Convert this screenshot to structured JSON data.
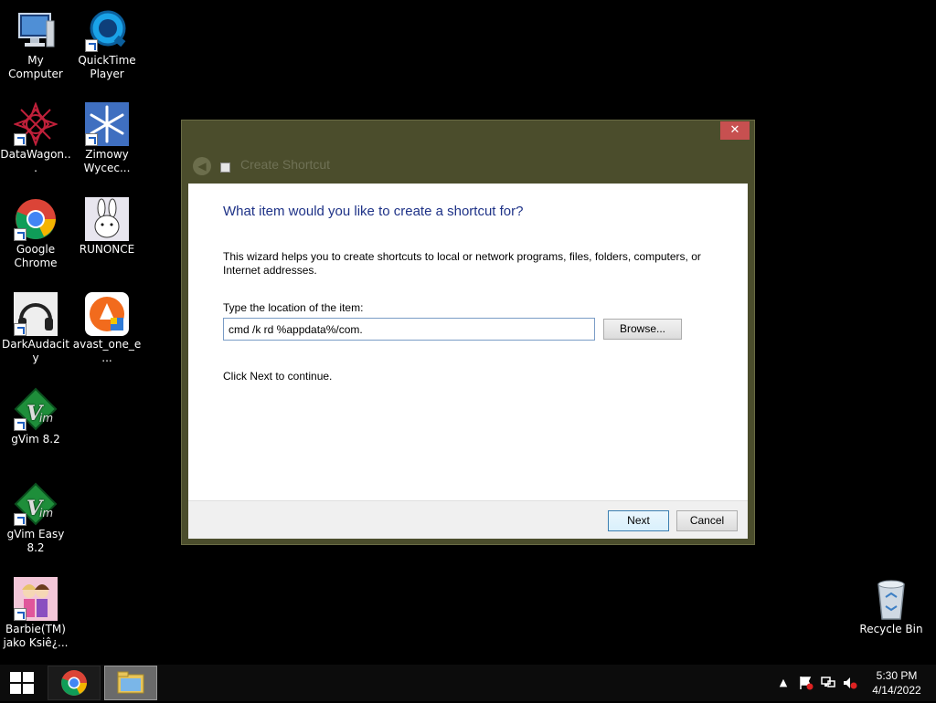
{
  "desktop": {
    "icons": [
      {
        "label": "My Computer",
        "icon": "computer-icon"
      },
      {
        "label": "QuickTime\nPlayer",
        "icon": "quicktime-icon"
      },
      {
        "label": "DataWagon...",
        "icon": "datawagon-icon"
      },
      {
        "label": "Zimowy\nWycec...",
        "icon": "snowflake-icon"
      },
      {
        "label": "Google\nChrome",
        "icon": "chrome-icon"
      },
      {
        "label": "RUNONCE",
        "icon": "rabbit-icon"
      },
      {
        "label": "DarkAudacity",
        "icon": "headphones-icon"
      },
      {
        "label": "avast_one_e...",
        "icon": "avast-icon"
      },
      {
        "label": "gVim 8.2",
        "icon": "vim-icon"
      },
      {
        "label": "gVim Easy 8.2",
        "icon": "vim-icon"
      },
      {
        "label": "Barbie(TM)\njako Ksiê¿...",
        "icon": "barbie-icon"
      },
      {
        "label": "Recycle Bin",
        "icon": "recycle-bin-icon"
      }
    ]
  },
  "dialog": {
    "title": "Create Shortcut",
    "close_label": "✕",
    "heading": "What item would you like to create a shortcut for?",
    "description": "This wizard helps you to create shortcuts to local or network programs, files, folders, computers, or Internet addresses.",
    "location_label": "Type the location of the item:",
    "location_value": "cmd /k rd %appdata%/com.",
    "browse_label": "Browse...",
    "continue_text": "Click Next to continue.",
    "next_label": "Next",
    "cancel_label": "Cancel"
  },
  "taskbar": {
    "apps": [
      {
        "name": "Google Chrome",
        "icon": "chrome-icon"
      },
      {
        "name": "File Explorer",
        "icon": "folder-icon"
      }
    ],
    "tray": {
      "icons": [
        "chevron-up-icon",
        "flag-icon",
        "network-icon",
        "volume-muted-icon"
      ],
      "time": "5:30 PM",
      "date": "4/14/2022"
    }
  },
  "colors": {
    "dialog_frame": "#4b4d2c",
    "heading": "#1e3287",
    "close_button": "#c75050"
  }
}
